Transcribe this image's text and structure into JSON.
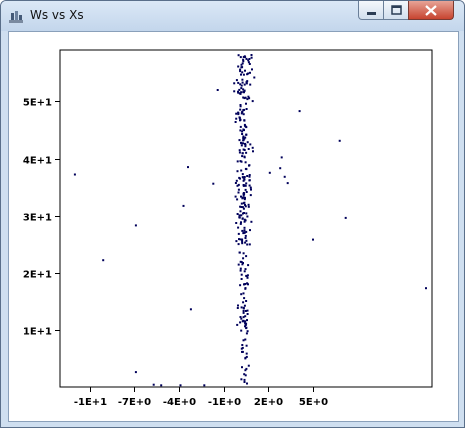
{
  "window": {
    "title": "Ws vs Xs",
    "icon": "chart-app-icon",
    "controls": [
      "minimize-icon",
      "maximize-icon",
      "close-icon"
    ]
  },
  "colors": {
    "points": "#00005a",
    "axis": "#000000",
    "background": "#ffffff"
  },
  "chart_data": {
    "type": "scatter",
    "title": "Ws vs Xs",
    "xlabel": "",
    "ylabel": "",
    "xlim": [
      -12,
      13
    ],
    "ylim": [
      0,
      59
    ],
    "grid": false,
    "x_ticks": [
      -10,
      -7,
      -4,
      -1,
      2,
      5
    ],
    "x_tick_labels": [
      "-1E+1",
      "-7E+0",
      "-4E+0",
      "-1E+0",
      "2E+0",
      "5E+0"
    ],
    "y_ticks": [
      10,
      20,
      30,
      40,
      50
    ],
    "y_tick_labels": [
      "1E+1",
      "2E+1",
      "3E+1",
      "4E+1",
      "5E+1"
    ],
    "outliers": [
      {
        "x": -11.0,
        "y": 37.2
      },
      {
        "x": -9.1,
        "y": 22.2
      },
      {
        "x": -6.9,
        "y": 28.3
      },
      {
        "x": -6.9,
        "y": 2.6
      },
      {
        "x": -5.7,
        "y": 0.4
      },
      {
        "x": -5.2,
        "y": 0.3
      },
      {
        "x": -3.9,
        "y": 0.3
      },
      {
        "x": -3.7,
        "y": 31.7
      },
      {
        "x": -3.4,
        "y": 38.5
      },
      {
        "x": -3.2,
        "y": 13.6
      },
      {
        "x": -2.3,
        "y": 0.3
      },
      {
        "x": -1.7,
        "y": 35.6
      },
      {
        "x": -1.4,
        "y": 52.0
      },
      {
        "x": 2.1,
        "y": 37.5
      },
      {
        "x": 2.8,
        "y": 38.3
      },
      {
        "x": 2.9,
        "y": 40.2
      },
      {
        "x": 3.1,
        "y": 36.8
      },
      {
        "x": 3.3,
        "y": 35.7
      },
      {
        "x": 4.1,
        "y": 48.3
      },
      {
        "x": 5.0,
        "y": 25.8
      },
      {
        "x": 6.8,
        "y": 43.1
      },
      {
        "x": 7.2,
        "y": 29.6
      },
      {
        "x": 12.6,
        "y": 17.3
      }
    ],
    "cluster": {
      "x_center": 0.35,
      "x_spread": 0.9,
      "y_range": [
        0.5,
        58.2
      ],
      "count": 320
    }
  }
}
